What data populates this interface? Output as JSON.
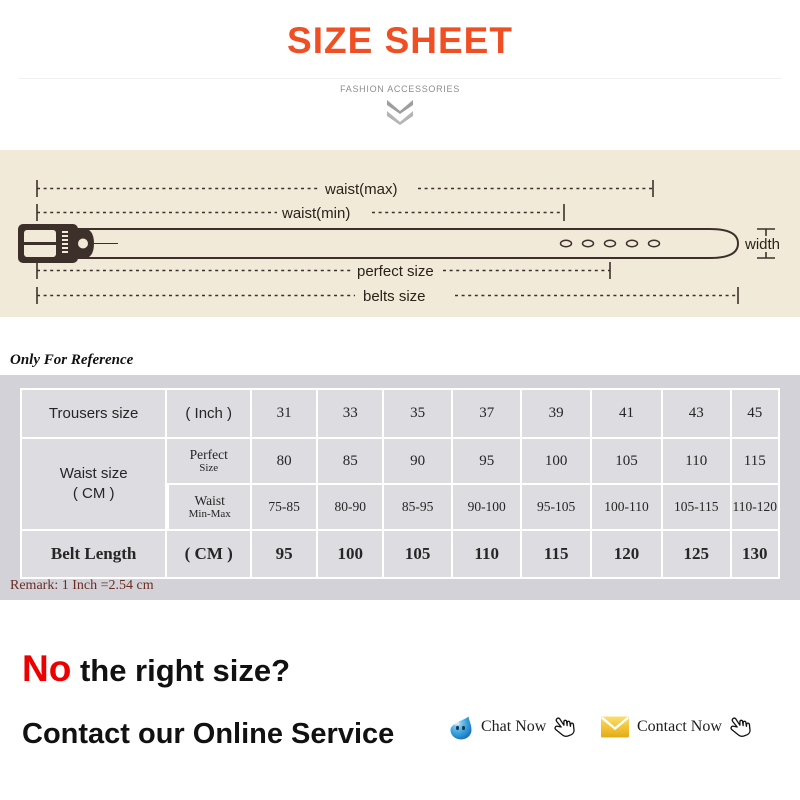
{
  "header": {
    "title": "SIZE SHEET",
    "subtitle": "FASHION ACCESSORIES",
    "chevron_icon": "double-chevron-down-icon",
    "title_color": "#f04e23",
    "subtitle_color": "#8d8d8d"
  },
  "diagram": {
    "background_color": "#f2ead9",
    "belt_color": "#3d302a",
    "labels": {
      "waist_max": "waist(max)",
      "waist_min": "waist(min)",
      "perfect_size": "perfect size",
      "belts_size": "belts size",
      "width": "width"
    },
    "hole_count": 5
  },
  "reference_note": "Only For Reference",
  "table": {
    "rows": [
      {
        "label": "Trousers size",
        "unit": "( Inch )",
        "values": [
          "31",
          "33",
          "35",
          "37",
          "39",
          "41",
          "43",
          "45"
        ]
      },
      {
        "label": "Waist size\n( CM )",
        "unit": "Perfect Size",
        "unit_main": "Perfect",
        "unit_sub": "Size",
        "values": [
          "80",
          "85",
          "90",
          "95",
          "100",
          "105",
          "110",
          "115"
        ]
      },
      {
        "unit_main": "Waist",
        "unit_sub": "Min-Max",
        "values": [
          "75-85",
          "80-90",
          "85-95",
          "90-100",
          "95-105",
          "100-110",
          "105-115",
          "110-120"
        ]
      },
      {
        "label": "Belt Length",
        "unit": "( CM )",
        "values": [
          "95",
          "100",
          "105",
          "110",
          "115",
          "120",
          "125",
          "130"
        ]
      }
    ],
    "waist_label_line1": "Waist size",
    "waist_label_line2": "( CM )",
    "background_color": "#d2d2d8",
    "cell_color": "#dcdce1"
  },
  "remark": "Remark: 1 Inch =2.54 cm",
  "contact": {
    "headline_no": "No",
    "headline_rest": " the right size?",
    "headline2": "Contact our Online Service",
    "chat": {
      "label": "Chat Now",
      "icon": "chat-bubble-face-icon",
      "cursor_icon": "hand-pointer-icon"
    },
    "mail": {
      "label": "Contact Now",
      "icon": "envelope-icon",
      "cursor_icon": "hand-pointer-icon"
    }
  }
}
